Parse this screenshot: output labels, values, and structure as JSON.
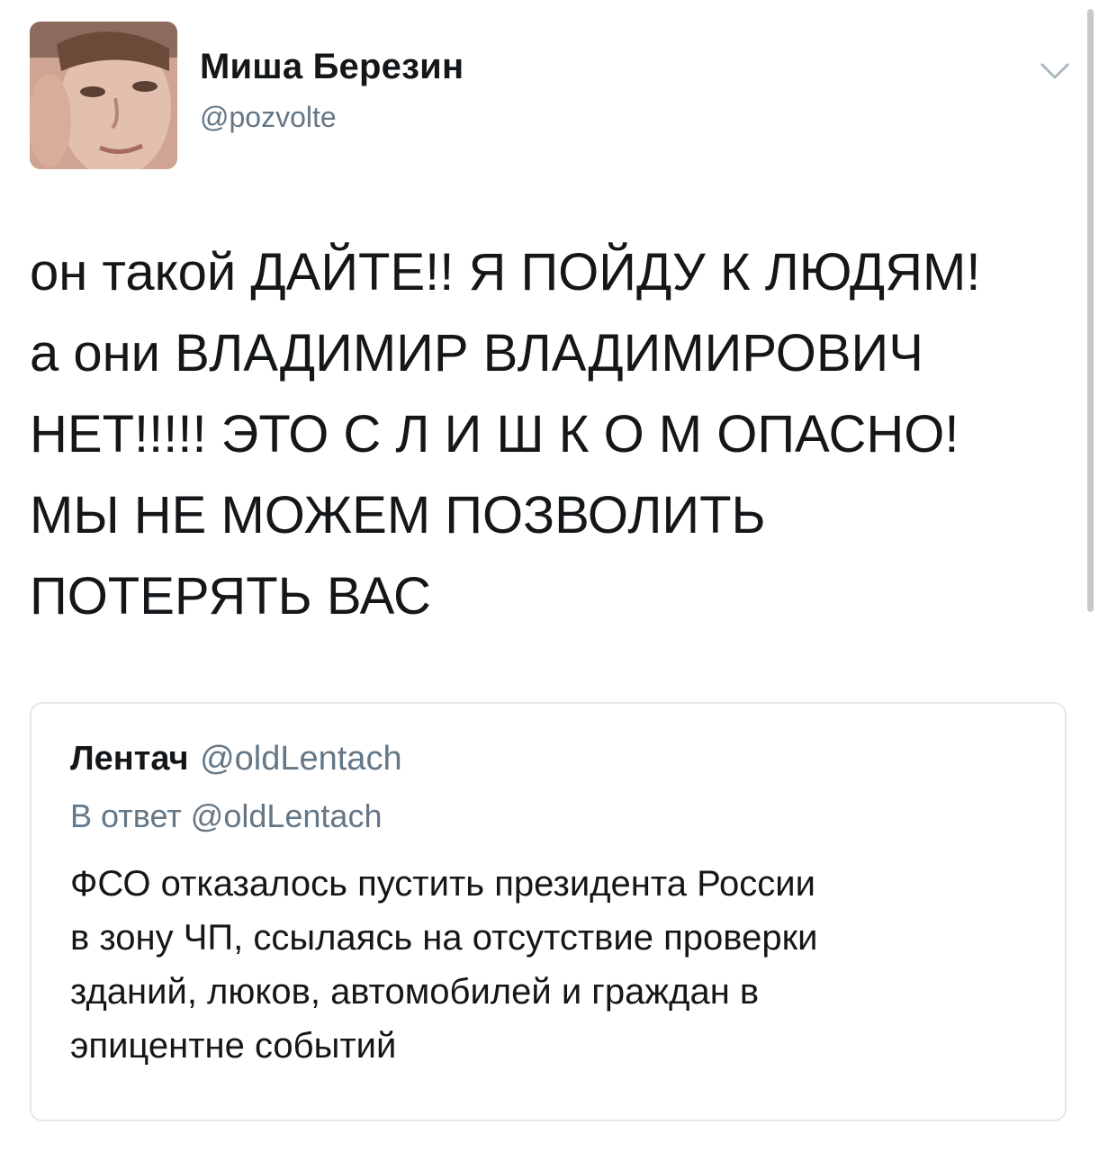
{
  "tweet": {
    "author": {
      "display_name": "Миша Березин",
      "handle": "@pozvolte",
      "avatar": "avatar-photo"
    },
    "menu_icon": "chevron-down-icon",
    "text_lines": [
      "он такой ДАЙТЕ!! Я ПОЙДУ К ЛЮДЯМ!",
      "а они ВЛАДИМИР ВЛАДИМИРОВИЧ",
      "НЕТ!!!!! ЭТО С Л И Ш К О М ОПАСНО!",
      "МЫ НЕ МОЖЕМ ПОЗВОЛИТЬ",
      "ПОТЕРЯТЬ ВАС"
    ]
  },
  "quoted_tweet": {
    "display_name": "Лентач",
    "handle": "@oldLentach",
    "reply_to": "В ответ @oldLentach",
    "text_lines": [
      "ФСО отказалось пустить президента России",
      "в зону ЧП, ссылаясь на отсутствие проверки",
      "зданий, люков, автомобилей и граждан в",
      "эпицентне событий"
    ]
  },
  "colors": {
    "primary_text": "#14171a",
    "secondary_text": "#657786",
    "border": "#e1e8ed",
    "chevron": "#aab8c2"
  }
}
